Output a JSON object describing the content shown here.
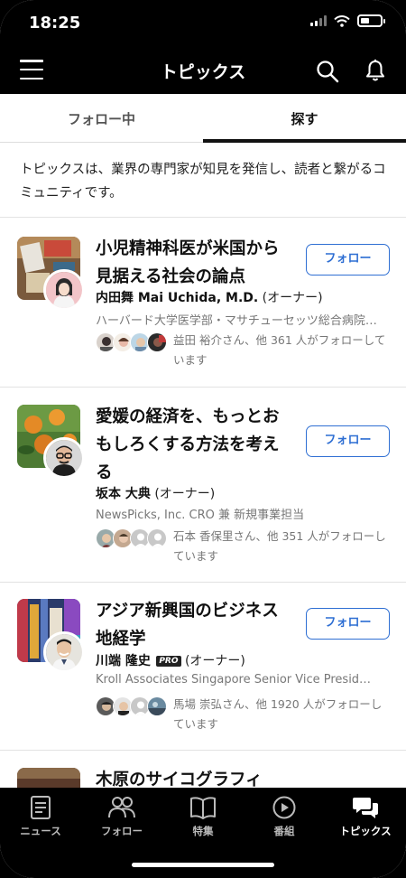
{
  "status_bar": {
    "time": "18:25"
  },
  "header": {
    "title": "トピックス"
  },
  "tabs": [
    {
      "label": "フォロー中",
      "active": false
    },
    {
      "label": "探す",
      "active": true
    }
  ],
  "intro": {
    "text": "トピックスは、業界の専門家が知見を発信し、読者と繋がるコミュニティです。"
  },
  "follow_label": "フォロー",
  "role_label": "(オーナー)",
  "topics": [
    {
      "title": "小児精神科医が米国から見据える社会の論点",
      "owner": "内田舞 Mai Uchida, M.D.",
      "pro": false,
      "org": "ハーバード大学医学部・マサチューセッツ総合病院…",
      "followers_text": "益田 裕介さん、他 361 人がフォローしています"
    },
    {
      "title": "愛媛の経済を、もっとおもしろくする方法を考える",
      "owner": "坂本 大典",
      "pro": false,
      "org": "NewsPicks, Inc. CRO 兼 新規事業担当",
      "followers_text": "石本 香保里さん、他 351 人がフォローしています"
    },
    {
      "title": "アジア新興国のビジネス地経学",
      "owner": "川端 隆史",
      "pro": true,
      "pro_label": "PRO",
      "org": "Kroll Associates Singapore Senior Vice Presid…",
      "followers_text": "馬場 崇弘さん、他 1920 人がフォローしています"
    },
    {
      "title": "木原のサイコグラフィ"
    }
  ],
  "bottom_nav": [
    {
      "label": "ニュース",
      "icon": "news-icon",
      "active": false
    },
    {
      "label": "フォロー",
      "icon": "people-icon",
      "active": false
    },
    {
      "label": "特集",
      "icon": "book-icon",
      "active": false
    },
    {
      "label": "番組",
      "icon": "play-icon",
      "active": false
    },
    {
      "label": "トピックス",
      "icon": "chat-bubbles-icon",
      "active": true
    }
  ],
  "colors": {
    "accent": "#2f6fd3",
    "header_bg": "#000000",
    "muted_text": "#777777"
  }
}
